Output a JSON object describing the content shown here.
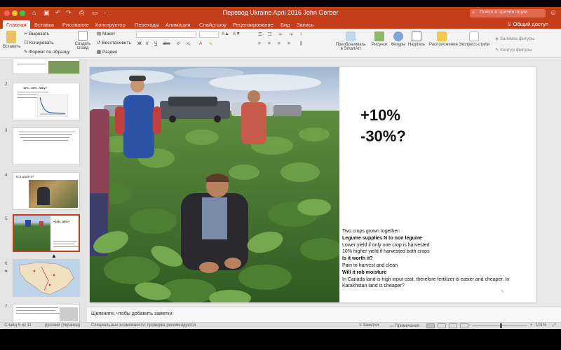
{
  "window": {
    "title": "Перевод Ukraine April 2016 John Gerber",
    "search_placeholder": "Поиск в презентации",
    "qat_icons": [
      "home-icon",
      "save-icon",
      "undo-icon",
      "redo-icon",
      "print-icon",
      "present-icon",
      "overflow-icon"
    ]
  },
  "tabs": [
    "Главная",
    "Вставка",
    "Рисование",
    "Конструктор",
    "Переходы",
    "Анимация",
    "Слайд-шоу",
    "Рецензирование",
    "Вид",
    "Запись"
  ],
  "active_tab": "Главная",
  "share_label": "Общий доступ",
  "ribbon": {
    "paste": "Вставить",
    "cut": "Вырезать",
    "copy": "Копировать",
    "format_painter": "Формат по образцу",
    "new_slide": "Создать слайд",
    "layout": "Макет",
    "reset": "Восстановить",
    "section": "Раздел",
    "convert_smartart": "Преобразовать в SmartArt",
    "picture": "Рисунок",
    "shapes": "Фигуры",
    "text_box": "Надпись",
    "arrange": "Расположение",
    "quick_styles": "Экспресс-стили",
    "shape_fill": "Заливка фигуры",
    "shape_outline": "Контур фигуры"
  },
  "thumbnails": [
    {
      "number": "",
      "title": ""
    },
    {
      "number": "2",
      "title": "10% - 30% - Why?"
    },
    {
      "number": "3",
      "title": ""
    },
    {
      "number": "4",
      "title": "Is it worth it?"
    },
    {
      "number": "5",
      "title": "+10% -30%?"
    },
    {
      "number": "6",
      "title": ""
    },
    {
      "number": "7",
      "title": ""
    }
  ],
  "selected_slide": 5,
  "slide": {
    "stat_line1": "+10%",
    "stat_line2": "-30%?",
    "bullets": [
      "Two crops grown together:",
      "Legume supplies N to non legume",
      "Lower yield if only one crop is harvested",
      "10% higher yield if harvested both crops",
      "Is it worth it?",
      "Pain to harvest and clean",
      "Will it rob moisture",
      "In Canada land is high input cost, therefore fertilizer is easier and cheaper. In Karakhstan land is cheaper?"
    ],
    "bullet_bold": [
      false,
      true,
      false,
      false,
      true,
      false,
      true,
      false
    ],
    "footer_mark": "5"
  },
  "notes_placeholder": "Щелкните, чтобы добавить заметки",
  "status": {
    "slide_count": "Слайд 5 из 11",
    "language": "русский (Украина)",
    "accessibility": "Специальные возможности: проверка рекомендуется",
    "notes_label": "Заметки",
    "comments_label": "Примечания",
    "zoom": "101%"
  },
  "colors": {
    "accent": "#c43e1c"
  }
}
